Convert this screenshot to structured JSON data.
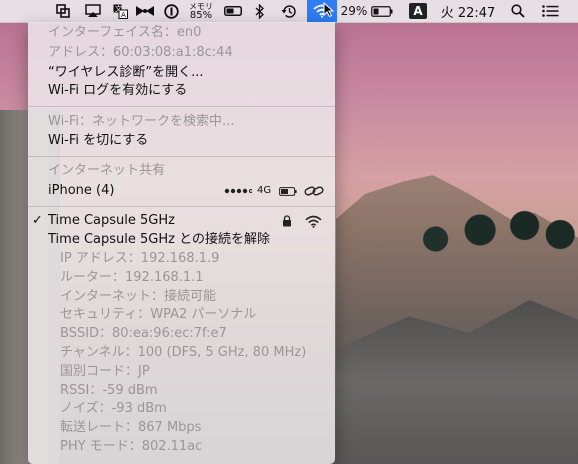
{
  "menubar": {
    "memory_label": "メモリ",
    "memory_value": "85%",
    "battery_percent": "29%",
    "input_source": "A",
    "clock": "火 22:47"
  },
  "wifi_menu": {
    "interface_name": "インターフェイス名：en0",
    "address": "アドレス：60:03:08:a1:8c:44",
    "open_diagnostics": "“ワイヤレス診断”を開く...",
    "enable_logging": "Wi-Fi ログを有効にする",
    "searching": "Wi-Fi：ネットワークを検索中...",
    "turn_off": "Wi-Fi を切にする",
    "hotspot_header": "インターネット共有",
    "hotspot_device": "iPhone (4)",
    "hotspot_signal_type": "4G",
    "network_name": "Time Capsule 5GHz",
    "disconnect": "Time Capsule 5GHz との接続を解除",
    "details": [
      "IP アドレス：192.168.1.9",
      "ルーター：192.168.1.1",
      "インターネット：接続可能",
      "セキュリティ：WPA2 パーソナル",
      "BSSID：80:ea:96:ec:7f:e7",
      "チャンネル：100 (DFS, 5 GHz, 80 MHz)",
      "国別コード：JP",
      "RSSI：-59 dBm",
      "ノイズ：-93 dBm",
      "転送レート：867 Mbps",
      "PHY モード：802.11ac"
    ]
  },
  "colors": {
    "wifi_highlight": "#2f7cf6",
    "menu_text": "#111111",
    "menu_dim_text": "#9a9698"
  }
}
